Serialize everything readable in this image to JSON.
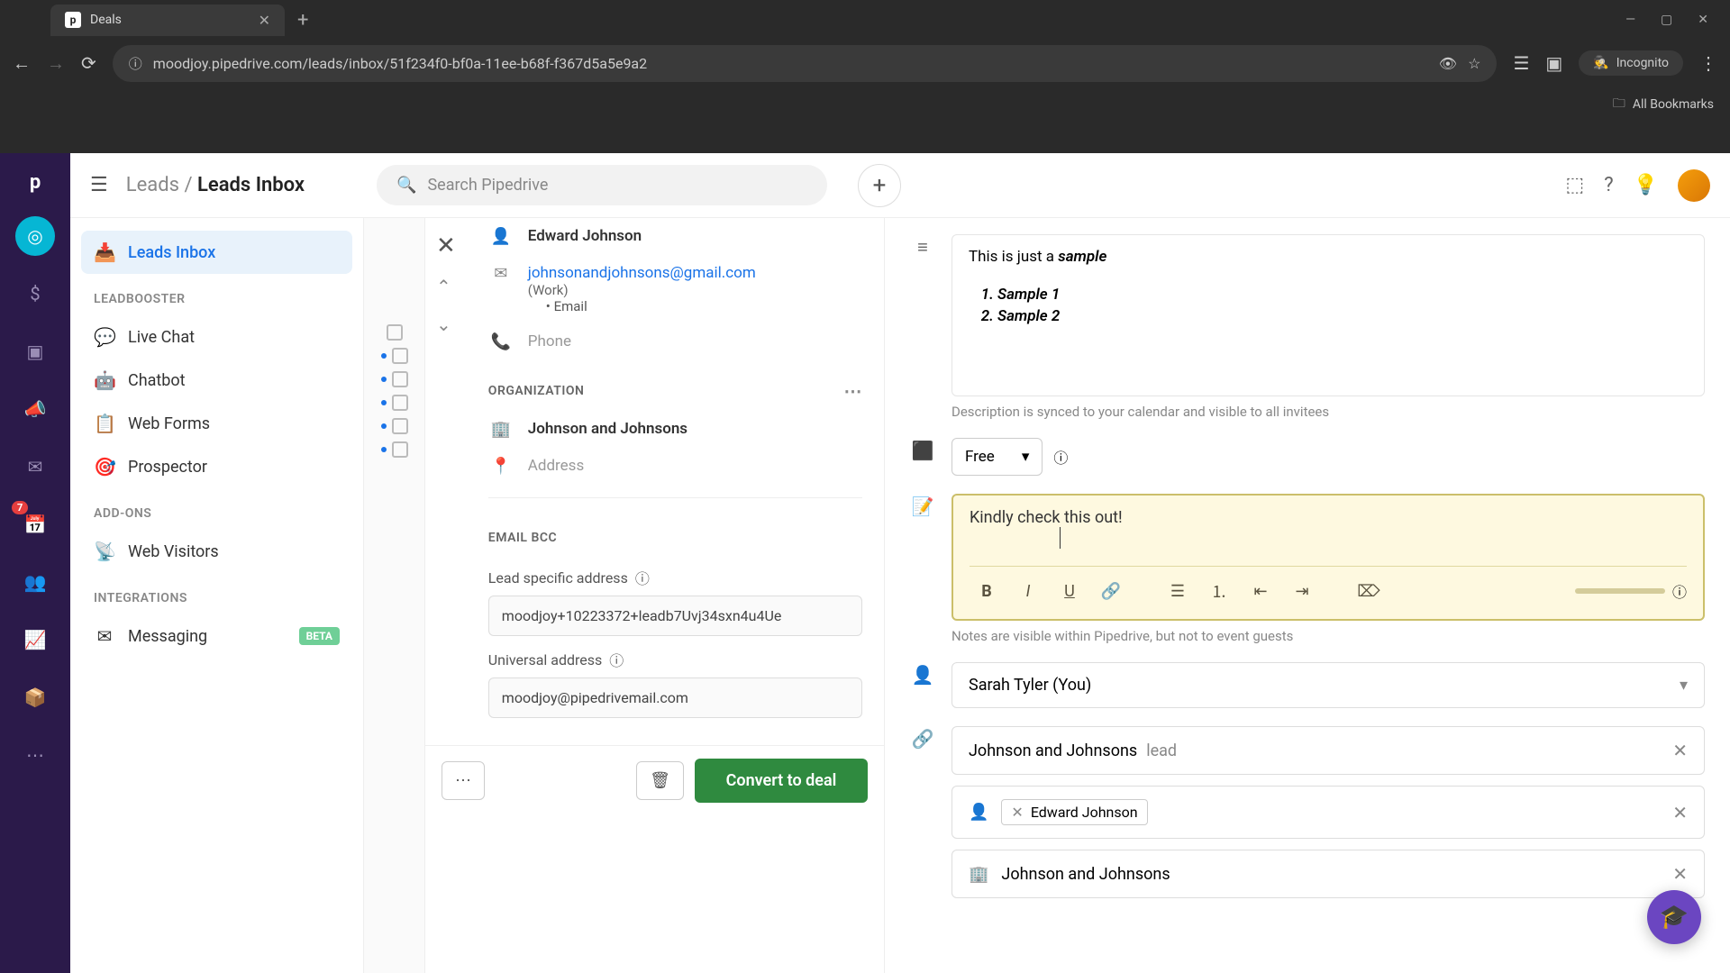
{
  "browser": {
    "tab_title": "Deals",
    "url": "moodjoy.pipedrive.com/leads/inbox/51f234f0-bf0a-11ee-b68f-f367d5a5e9a2",
    "incognito_label": "Incognito",
    "all_bookmarks": "All Bookmarks"
  },
  "header": {
    "breadcrumb_root": "Leads",
    "breadcrumb_current": "Leads Inbox",
    "search_placeholder": "Search Pipedrive"
  },
  "rail": {
    "badge_count": "7"
  },
  "sidebar": {
    "inbox": "Leads Inbox",
    "section_leadbooster": "LEADBOOSTER",
    "live_chat": "Live Chat",
    "chatbot": "Chatbot",
    "web_forms": "Web Forms",
    "prospector": "Prospector",
    "section_addons": "ADD-ONS",
    "web_visitors": "Web Visitors",
    "section_integrations": "INTEGRATIONS",
    "messaging": "Messaging",
    "beta_label": "BETA"
  },
  "detail": {
    "contact_name": "Edward Johnson",
    "email": "johnsonandjohnsons@gmail.com",
    "email_label": "(Work)",
    "email_bullet": "Email",
    "phone_placeholder": "Phone",
    "section_org": "ORGANIZATION",
    "org_name": "Johnson and Johnsons",
    "address_placeholder": "Address",
    "section_email_bcc": "EMAIL BCC",
    "lead_specific_label": "Lead specific address",
    "lead_specific_value": "moodjoy+10223372+leadb7Uvj34sxn4u4Ue",
    "universal_label": "Universal address",
    "universal_value": "moodjoy@pipedrivemail.com",
    "convert_btn": "Convert to deal"
  },
  "activity": {
    "desc_prefix": "This is just a ",
    "desc_sample": "sample",
    "list_item_1": "Sample 1",
    "list_item_2": "Sample 2",
    "desc_help": "Description is synced to your calendar and visible to all invitees",
    "availability": "Free",
    "note_text": "Kindly check this out!",
    "note_help": "Notes are visible within Pipedrive, but not to event guests",
    "owner": "Sarah Tyler (You)",
    "linked_lead_name": "Johnson and Johnsons",
    "linked_lead_tag": "lead",
    "participant_name": "Edward Johnson",
    "linked_org": "Johnson and Johnsons"
  }
}
